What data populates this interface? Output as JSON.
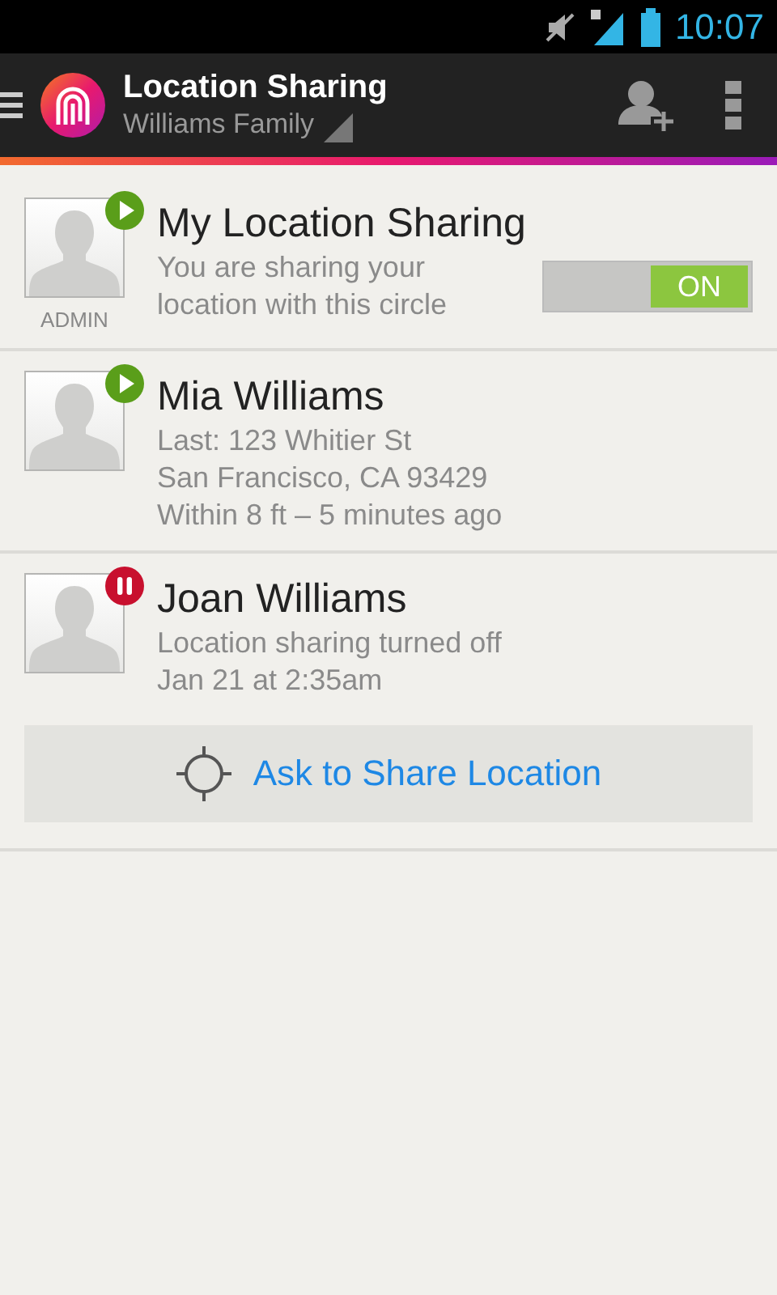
{
  "status_bar": {
    "time": "10:07"
  },
  "app_bar": {
    "title": "Location Sharing",
    "subtitle": "Williams Family"
  },
  "members": [
    {
      "kind": "self",
      "name": "My Location Sharing",
      "sharing": true,
      "role": "ADMIN",
      "lines": [
        "You are sharing your location with this circle"
      ],
      "toggle": {
        "label": "ON",
        "on": true
      }
    },
    {
      "kind": "member",
      "name": "Mia Williams",
      "sharing": true,
      "lines": [
        "Last: 123 Whitier St",
        "San Francisco, CA 93429",
        "Within 8 ft – 5 minutes ago"
      ]
    },
    {
      "kind": "member",
      "name": "Joan Williams",
      "sharing": false,
      "lines": [
        "Location sharing turned off",
        "Jan 21 at 2:35am"
      ],
      "action": "Ask to Share Location"
    }
  ]
}
